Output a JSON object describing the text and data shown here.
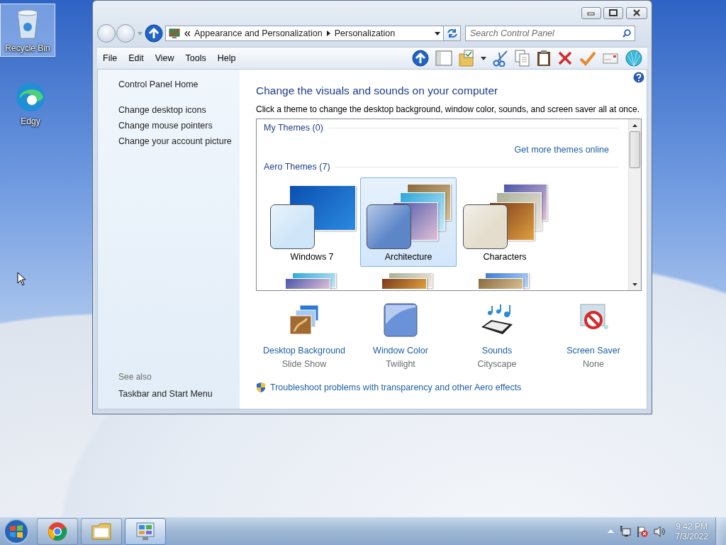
{
  "desktop_icons": [
    {
      "label": "Recycle Bin",
      "kind": "recycle",
      "selected": true
    },
    {
      "label": "Edgy",
      "kind": "edge",
      "selected": false
    }
  ],
  "window": {
    "address": {
      "crumbs": [
        "Appearance and Personalization",
        "Personalization"
      ]
    },
    "search": {
      "placeholder": "Search Control Panel"
    },
    "menu": [
      "File",
      "Edit",
      "View",
      "Tools",
      "Help"
    ],
    "sidebar": {
      "links": [
        "Control Panel Home",
        "Change desktop icons",
        "Change mouse pointers",
        "Change your account picture"
      ],
      "see_also": {
        "heading": "See also",
        "links": [
          "Taskbar and Start Menu"
        ]
      }
    },
    "content": {
      "title": "Change the visuals and sounds on your computer",
      "description": "Click a theme to change the desktop background, window color, sounds, and screen saver all at once.",
      "my_themes": {
        "heading": "My Themes (0)",
        "link": "Get more themes online"
      },
      "aero_themes": {
        "heading": "Aero Themes (7)",
        "themes": [
          {
            "name": "Windows 7",
            "kind": "single",
            "selected": false,
            "color": "#cfe6f8"
          },
          {
            "name": "Architecture",
            "kind": "stack",
            "selected": true,
            "color": "#5d86c9"
          },
          {
            "name": "Characters",
            "kind": "stack",
            "selected": false,
            "color": "#e4ddcc"
          }
        ]
      },
      "settings": [
        {
          "label": "Desktop Background",
          "value": "Slide Show",
          "kind": "background"
        },
        {
          "label": "Window Color",
          "value": "Twilight",
          "kind": "color"
        },
        {
          "label": "Sounds",
          "value": "Cityscape",
          "kind": "sounds"
        },
        {
          "label": "Screen Saver",
          "value": "None",
          "kind": "screensaver"
        }
      ],
      "troubleshoot": "Troubleshoot problems with transparency and other Aero effects"
    }
  },
  "taskbar": {
    "apps": [
      {
        "kind": "chrome",
        "selected": false
      },
      {
        "kind": "explorer",
        "selected": false
      },
      {
        "kind": "control-panel",
        "selected": true
      }
    ],
    "clock": {
      "time": "9:42 PM",
      "date": "7/3/2022"
    }
  }
}
